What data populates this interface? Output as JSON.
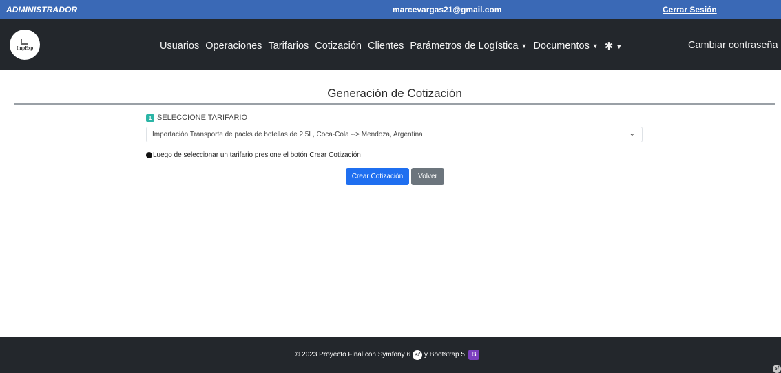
{
  "topbar": {
    "role": "ADMINISTRADOR",
    "email": "marcevargas21@gmail.com",
    "logout": "Cerrar Sesión"
  },
  "navbar": {
    "logo_text": "ImpExp",
    "items": [
      {
        "label": "Usuarios"
      },
      {
        "label": "Operaciones"
      },
      {
        "label": "Tarifarios"
      },
      {
        "label": "Cotización"
      },
      {
        "label": "Clientes"
      },
      {
        "label": "Parámetros de Logística"
      },
      {
        "label": "Documentos"
      }
    ],
    "right_link": "Cambiar contraseña",
    "caret": "▼",
    "gear": "✱"
  },
  "main": {
    "title": "Generación de Cotización",
    "step_number": "1",
    "step_label": "SELECCIONE TARIFARIO",
    "select_value": "Importación Transporte de packs de botellas de 2.5L, Coca-Cola --> Mendoza, Argentina",
    "hint": "Luego de seleccionar un tarifario presione el botón Crear Cotización",
    "create_button": "Crear Cotización",
    "back_button": "Volver"
  },
  "footer": {
    "text_before": "® 2023 Proyecto Final con Symfony 6",
    "text_middle": "y Bootstrap 5",
    "symfony_glyph": "sf",
    "bootstrap_glyph": "B"
  }
}
